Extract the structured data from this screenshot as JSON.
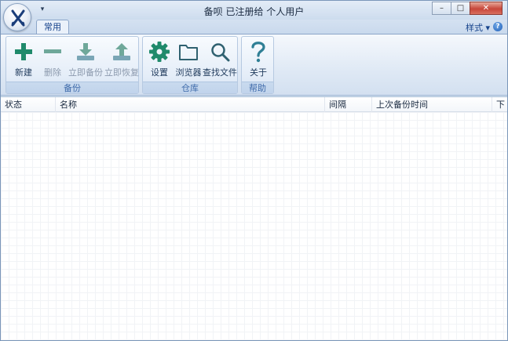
{
  "window": {
    "title": "备呗  已注册给  个人用户",
    "controls": {
      "minimize": "–",
      "maximize": "□",
      "close": "✕"
    }
  },
  "qat": {
    "arrow": "▾"
  },
  "tabs": [
    {
      "label": "常用",
      "active": true
    }
  ],
  "right_menu": {
    "style_label": "样式 ▾",
    "help_label": "?"
  },
  "ribbon": {
    "groups": [
      {
        "label": "备份",
        "buttons": [
          {
            "label": "新建",
            "icon": "plus-icon",
            "enabled": true
          },
          {
            "label": "删除",
            "icon": "minus-icon",
            "enabled": false
          },
          {
            "label": "立即备份",
            "icon": "download-tray-icon",
            "enabled": false
          },
          {
            "label": "立即恢复",
            "icon": "upload-tray-icon",
            "enabled": false
          }
        ]
      },
      {
        "label": "仓库",
        "buttons": [
          {
            "label": "设置",
            "icon": "gear-icon",
            "enabled": true
          },
          {
            "label": "浏览器",
            "icon": "folder-icon",
            "enabled": true
          },
          {
            "label": "查找文件",
            "icon": "search-icon",
            "enabled": true
          }
        ]
      },
      {
        "label": "帮助",
        "buttons": [
          {
            "label": "关于",
            "icon": "question-icon",
            "enabled": true
          }
        ]
      }
    ]
  },
  "table": {
    "columns": [
      "状态",
      "名称",
      "间隔",
      "上次备份时间",
      "下"
    ],
    "rows": []
  },
  "colors": {
    "icon_green": "#1f8a6b",
    "icon_teal": "#2f7f95",
    "ribbon_blue": "#dfe9f5",
    "group_label_blue": "#3e6aaa"
  }
}
